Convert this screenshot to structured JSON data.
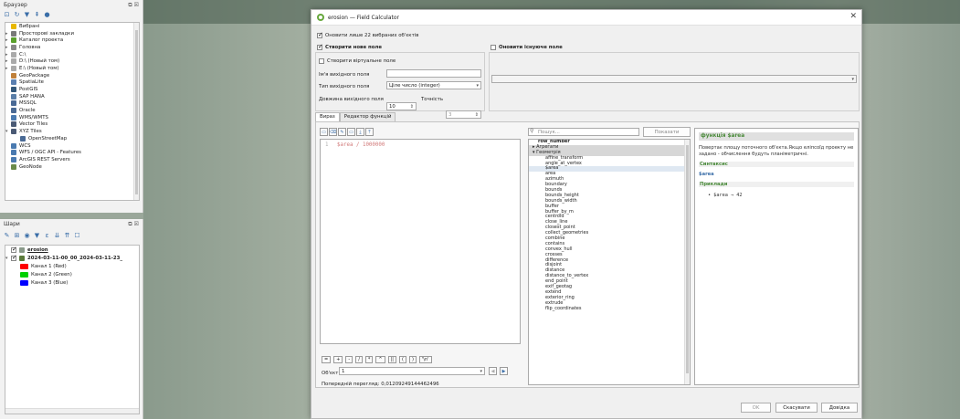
{
  "browser": {
    "title": "Браузер",
    "items": [
      {
        "label": "Вибрані",
        "exp": "",
        "icon": "star-icon",
        "color": "#e8b800"
      },
      {
        "label": "Просторові закладки",
        "exp": "▸",
        "icon": "bookmark-icon",
        "color": "#7a7a7a"
      },
      {
        "label": "Каталог проекта",
        "exp": "▸",
        "icon": "project-folder-icon",
        "color": "#5aa02c"
      },
      {
        "label": "Головна",
        "exp": "▸",
        "icon": "home-icon",
        "color": "#888"
      },
      {
        "label": "C:\\",
        "exp": "▸",
        "icon": "drive-icon",
        "color": "#aaa"
      },
      {
        "label": "D:\\ (Новый том)",
        "exp": "▸",
        "icon": "drive-icon",
        "color": "#aaa"
      },
      {
        "label": "E:\\ (Новый том)",
        "exp": "▸",
        "icon": "drive-icon",
        "color": "#aaa"
      },
      {
        "label": "GeoPackage",
        "exp": "",
        "icon": "geopackage-icon",
        "color": "#c0803a"
      },
      {
        "label": "SpatiaLite",
        "exp": "",
        "icon": "spatialite-icon",
        "color": "#5a7fb0"
      },
      {
        "label": "PostGIS",
        "exp": "",
        "icon": "postgis-icon",
        "color": "#33587a"
      },
      {
        "label": "SAP HANA",
        "exp": "",
        "icon": "saphana-icon",
        "color": "#5b7fa8"
      },
      {
        "label": "MSSQL",
        "exp": "",
        "icon": "mssql-icon",
        "color": "#4a6a95"
      },
      {
        "label": "Oracle",
        "exp": "",
        "icon": "oracle-icon",
        "color": "#4a6a95"
      },
      {
        "label": "WMS/WMTS",
        "exp": "",
        "icon": "globe-icon",
        "color": "#4a7ab0"
      },
      {
        "label": "Vector Tiles",
        "exp": "",
        "icon": "grid-icon",
        "color": "#4a5a75"
      },
      {
        "label": "XYZ Tiles",
        "exp": "▾",
        "icon": "grid-icon",
        "color": "#4a5a75"
      },
      {
        "label": "OpenStreetMap",
        "exp": "",
        "icon": "grid-icon",
        "color": "#4a6a95",
        "indent": true
      },
      {
        "label": "WCS",
        "exp": "",
        "icon": "globe-icon",
        "color": "#4a7ab0"
      },
      {
        "label": "WFS / OGC API - Features",
        "exp": "",
        "icon": "globe-icon",
        "color": "#4a7ab0"
      },
      {
        "label": "ArcGIS REST Servers",
        "exp": "",
        "icon": "arcgis-icon",
        "color": "#4a7ab0"
      },
      {
        "label": "GeoNode",
        "exp": "",
        "icon": "geonode-icon",
        "color": "#6a8a4a"
      }
    ]
  },
  "layers": {
    "title": "Шари",
    "items": [
      {
        "label": "erosion",
        "underline": true,
        "checked": true,
        "indent": 0
      },
      {
        "label": "2024-03-11-00_00_2024-03-11-23_",
        "underline": false,
        "checked": true,
        "indent": 0
      },
      {
        "label": "Канал 1 (Red)",
        "swatch": "#ff0000",
        "indent": 1
      },
      {
        "label": "Канал 2 (Green)",
        "swatch": "#00d000",
        "indent": 1
      },
      {
        "label": "Канал 3 (Blue)",
        "swatch": "#0000ff",
        "indent": 1
      }
    ]
  },
  "dialog": {
    "title": "erosion — Field Calculator",
    "update_selected": "Оновити лише 22 вибраних об'єктів",
    "create_new_field": "Створити нове поле",
    "update_existing": "Оновити існуюче поле",
    "create_virtual": "Створити віртуальне поле",
    "output_name_label": "Ім'я вихідного поля",
    "output_name_value": "",
    "output_type_label": "Тип вихідного поля",
    "output_type_value": "Ціле число (integer)",
    "length_label": "Довжина вихідного поля",
    "length_value": "10",
    "precision_label": "Точність",
    "precision_value": "3",
    "tab_expression": "Вираз",
    "tab_function_editor": "Редактор функцій",
    "expression_field": "$area",
    "expression_op": "/",
    "expression_number": "1000000",
    "operators": [
      "=",
      "+",
      "-",
      "/",
      "*",
      "^",
      "||",
      "(",
      ")",
      "'\\n'"
    ],
    "feature_label": "Об'єкт",
    "feature_value": "1",
    "preview_label": "Попередній перегляд:",
    "preview_value": "0,01209249144462496",
    "search_placeholder": "Пошук...",
    "show_help": "Показати довідку",
    "functions": [
      {
        "label": "row_number",
        "bold": true,
        "indent": 0,
        "exp": ""
      },
      {
        "label": "Агрегати",
        "indent": 0,
        "exp": "▸",
        "group": true
      },
      {
        "label": "Геометрія",
        "indent": 0,
        "exp": "▾",
        "group": true
      },
      {
        "label": "affine_transform",
        "indent": 1
      },
      {
        "label": "angle_at_vertex",
        "indent": 1
      },
      {
        "label": "$area",
        "indent": 1,
        "selected": true
      },
      {
        "label": "area",
        "indent": 1
      },
      {
        "label": "azimuth",
        "indent": 1
      },
      {
        "label": "boundary",
        "indent": 1
      },
      {
        "label": "bounds",
        "indent": 1
      },
      {
        "label": "bounds_height",
        "indent": 1
      },
      {
        "label": "bounds_width",
        "indent": 1
      },
      {
        "label": "buffer",
        "indent": 1
      },
      {
        "label": "buffer_by_m",
        "indent": 1
      },
      {
        "label": "centroid",
        "indent": 1
      },
      {
        "label": "close_line",
        "indent": 1
      },
      {
        "label": "closest_point",
        "indent": 1
      },
      {
        "label": "collect_geometries",
        "indent": 1
      },
      {
        "label": "combine",
        "indent": 1
      },
      {
        "label": "contains",
        "indent": 1
      },
      {
        "label": "convex_hull",
        "indent": 1
      },
      {
        "label": "crosses",
        "indent": 1
      },
      {
        "label": "difference",
        "indent": 1
      },
      {
        "label": "disjoint",
        "indent": 1
      },
      {
        "label": "distance",
        "indent": 1
      },
      {
        "label": "distance_to_vertex",
        "indent": 1
      },
      {
        "label": "end_point",
        "indent": 1
      },
      {
        "label": "exif_geotag",
        "indent": 1
      },
      {
        "label": "extend",
        "indent": 1
      },
      {
        "label": "exterior_ring",
        "indent": 1
      },
      {
        "label": "extrude",
        "indent": 1
      },
      {
        "label": "flip_coordinates",
        "indent": 1
      }
    ],
    "help_title": "функція $area",
    "help_desc": "Повертає площу поточного об'єкта.Якщо еліпсоїд проекту не задано - обчислення будуть планіметричні.",
    "help_syntax_head": "Синтаксис",
    "help_syntax": "$area",
    "help_examples_head": "Приклади",
    "help_example": "• $area → 42",
    "ok": "OK",
    "cancel": "Скасувати",
    "help": "Довідка"
  }
}
